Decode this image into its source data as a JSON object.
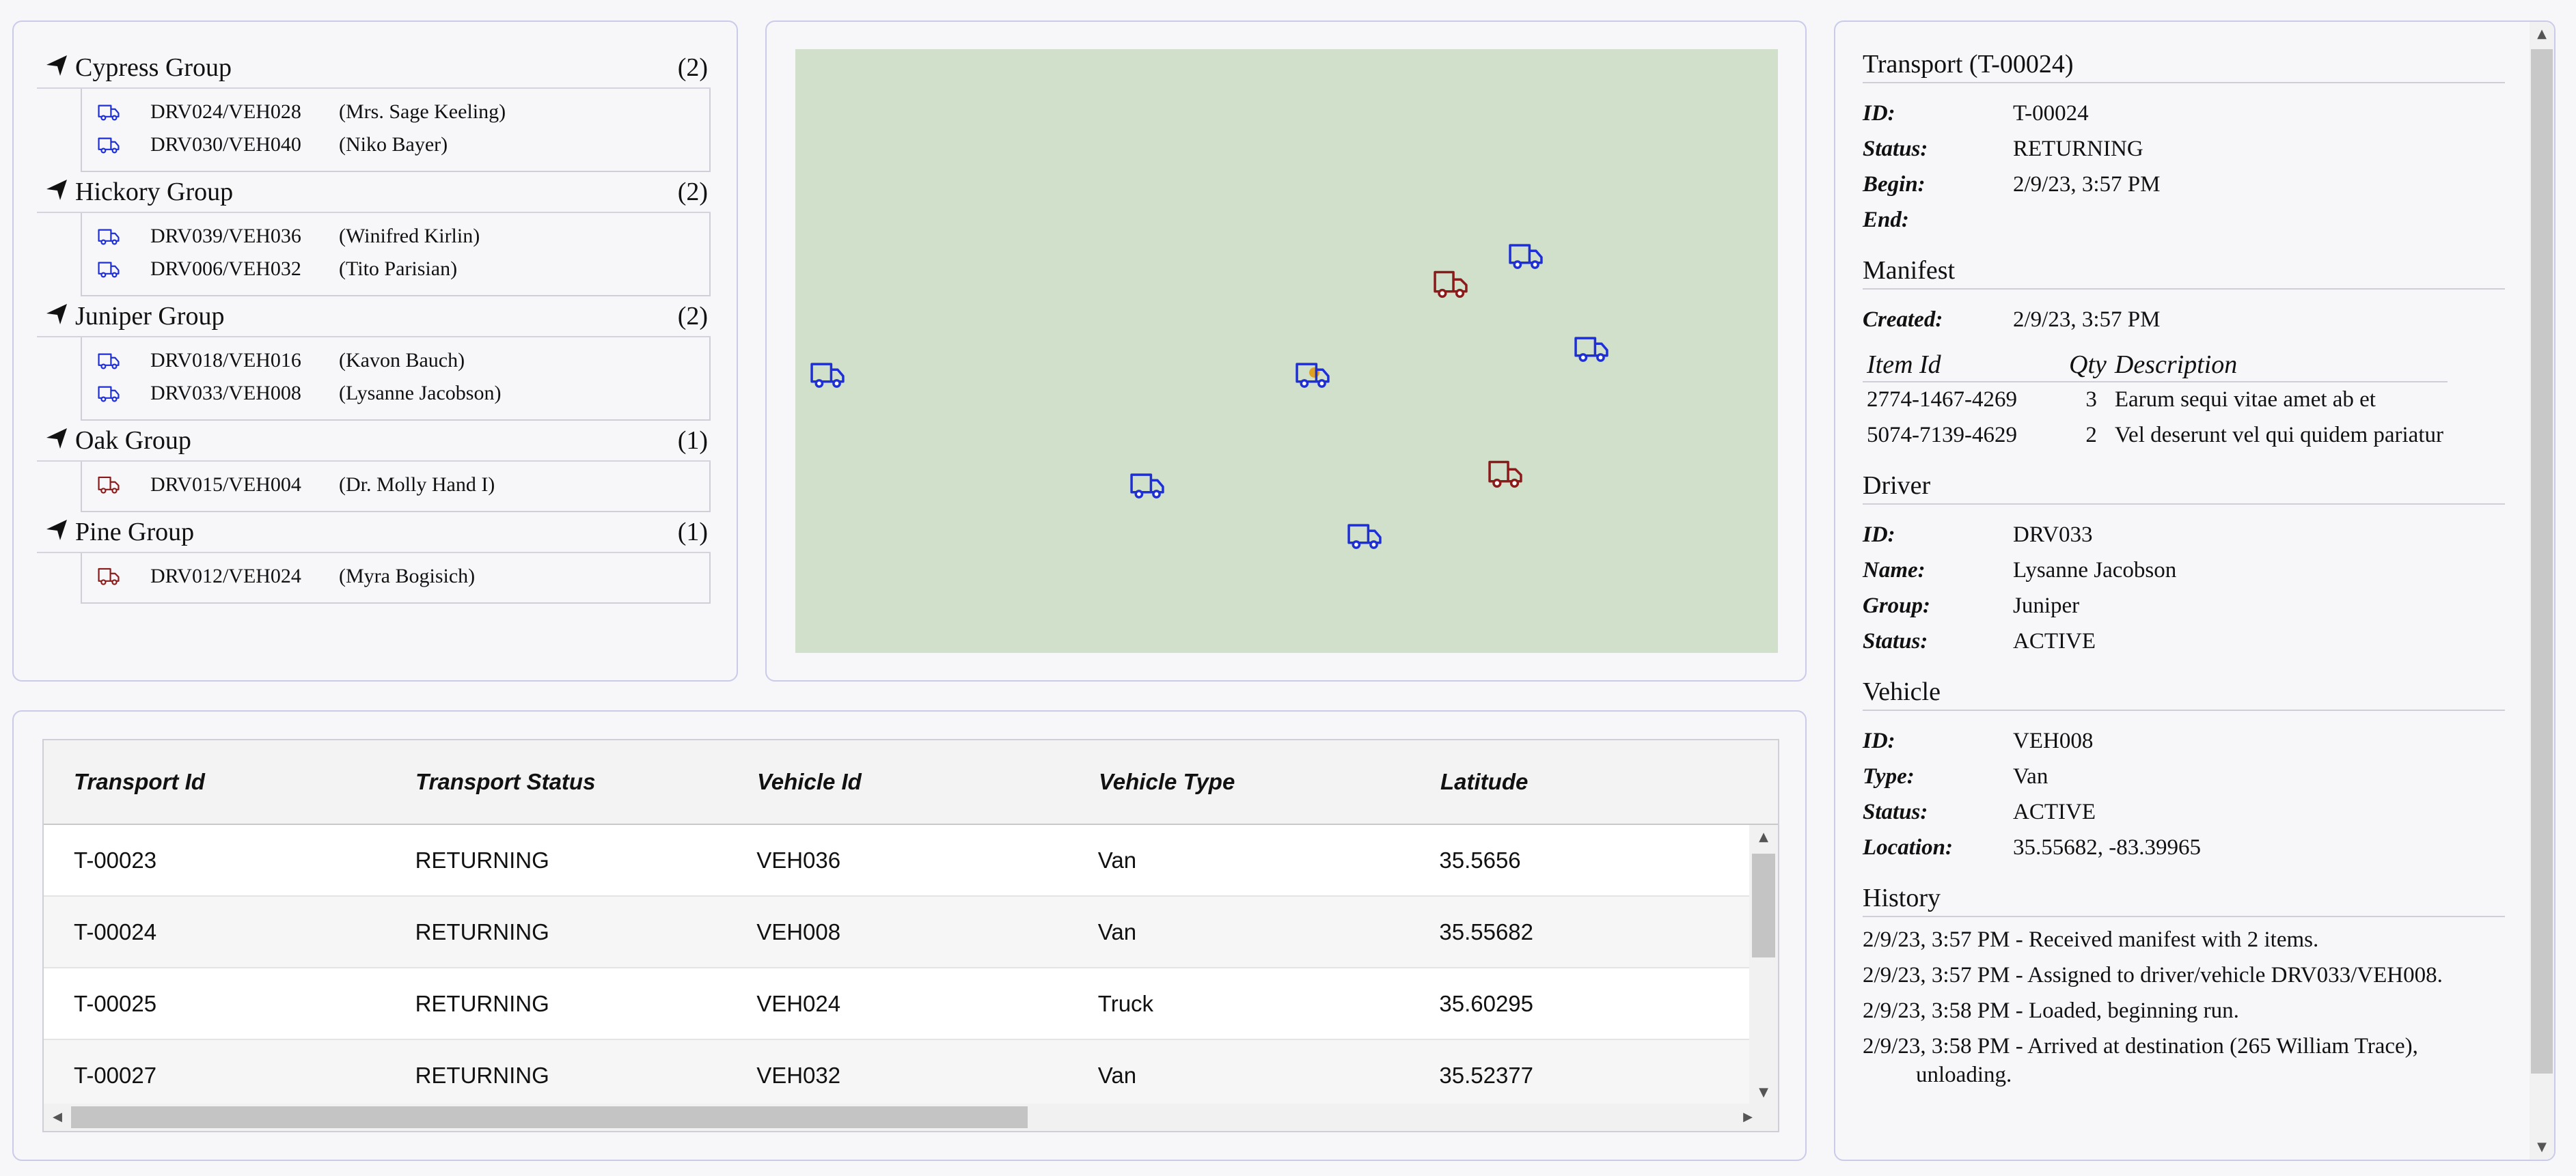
{
  "colors": {
    "van": "#1f2fd6",
    "truck": "#8b1a1a",
    "map_bg": "#d0e0cb",
    "panel_border": "#c9cbe8",
    "dot": "#e0a020"
  },
  "groups": [
    {
      "name": "Cypress Group",
      "count": "(2)",
      "vehicles": [
        {
          "id": "DRV024/VEH028",
          "driver": "(Mrs. Sage Keeling)",
          "type": "van"
        },
        {
          "id": "DRV030/VEH040",
          "driver": "(Niko Bayer)",
          "type": "van"
        }
      ]
    },
    {
      "name": "Hickory Group",
      "count": "(2)",
      "vehicles": [
        {
          "id": "DRV039/VEH036",
          "driver": "(Winifred Kirlin)",
          "type": "van"
        },
        {
          "id": "DRV006/VEH032",
          "driver": "(Tito Parisian)",
          "type": "van"
        }
      ]
    },
    {
      "name": "Juniper Group",
      "count": "(2)",
      "vehicles": [
        {
          "id": "DRV018/VEH016",
          "driver": "(Kavon Bauch)",
          "type": "van"
        },
        {
          "id": "DRV033/VEH008",
          "driver": "(Lysanne Jacobson)",
          "type": "van"
        }
      ]
    },
    {
      "name": "Oak Group",
      "count": "(1)",
      "vehicles": [
        {
          "id": "DRV015/VEH004",
          "driver": "(Dr. Molly Hand I)",
          "type": "truck"
        }
      ]
    },
    {
      "name": "Pine Group",
      "count": "(1)",
      "vehicles": [
        {
          "id": "DRV012/VEH024",
          "driver": "(Myra Bogisich)",
          "type": "truck"
        }
      ]
    }
  ],
  "transport": {
    "title": "Transport (T-00024)",
    "fields": [
      {
        "label": "ID:",
        "value": "T-00024"
      },
      {
        "label": "Status:",
        "value": "RETURNING"
      },
      {
        "label": "Begin:",
        "value": "2/9/23, 3:57 PM"
      },
      {
        "label": "End:",
        "value": ""
      }
    ]
  },
  "manifest": {
    "title": "Manifest",
    "created_label": "Created:",
    "created_value": "2/9/23, 3:57 PM",
    "columns": [
      "Item Id",
      "Qty",
      "Description"
    ],
    "items": [
      {
        "item_id": "2774-1467-4269",
        "qty": "3",
        "description": "Earum sequi vitae amet ab et"
      },
      {
        "item_id": "5074-7139-4629",
        "qty": "2",
        "description": "Vel deserunt vel qui quidem pariatur"
      }
    ]
  },
  "driver": {
    "title": "Driver",
    "fields": [
      {
        "label": "ID:",
        "value": "DRV033"
      },
      {
        "label": "Name:",
        "value": "Lysanne Jacobson"
      },
      {
        "label": "Group:",
        "value": "Juniper"
      },
      {
        "label": "Status:",
        "value": "ACTIVE"
      }
    ]
  },
  "vehicle": {
    "title": "Vehicle",
    "fields": [
      {
        "label": "ID:",
        "value": "VEH008"
      },
      {
        "label": "Type:",
        "value": "Van"
      },
      {
        "label": "Status:",
        "value": "ACTIVE"
      },
      {
        "label": "Location:",
        "value": "35.55682, -83.39965"
      }
    ]
  },
  "history": {
    "title": "History",
    "entries": [
      "2/9/23, 3:57 PM - Received manifest with 2 items.",
      "2/9/23, 3:57 PM - Assigned to driver/vehicle DRV033/VEH008.",
      "2/9/23, 3:58 PM - Loaded, beginning run.",
      "2/9/23, 3:58 PM - Arrived at destination (265 William Trace), unloading."
    ]
  },
  "grid": {
    "columns": [
      "Transport Id",
      "Transport Status",
      "Vehicle Id",
      "Vehicle Type",
      "Latitude"
    ],
    "rows": [
      [
        "T-00023",
        "RETURNING",
        "VEH036",
        "Van",
        "35.5656"
      ],
      [
        "T-00024",
        "RETURNING",
        "VEH008",
        "Van",
        "35.55682"
      ],
      [
        "T-00025",
        "RETURNING",
        "VEH024",
        "Truck",
        "35.60295"
      ],
      [
        "T-00027",
        "RETURNING",
        "VEH032",
        "Van",
        "35.52377"
      ]
    ]
  }
}
